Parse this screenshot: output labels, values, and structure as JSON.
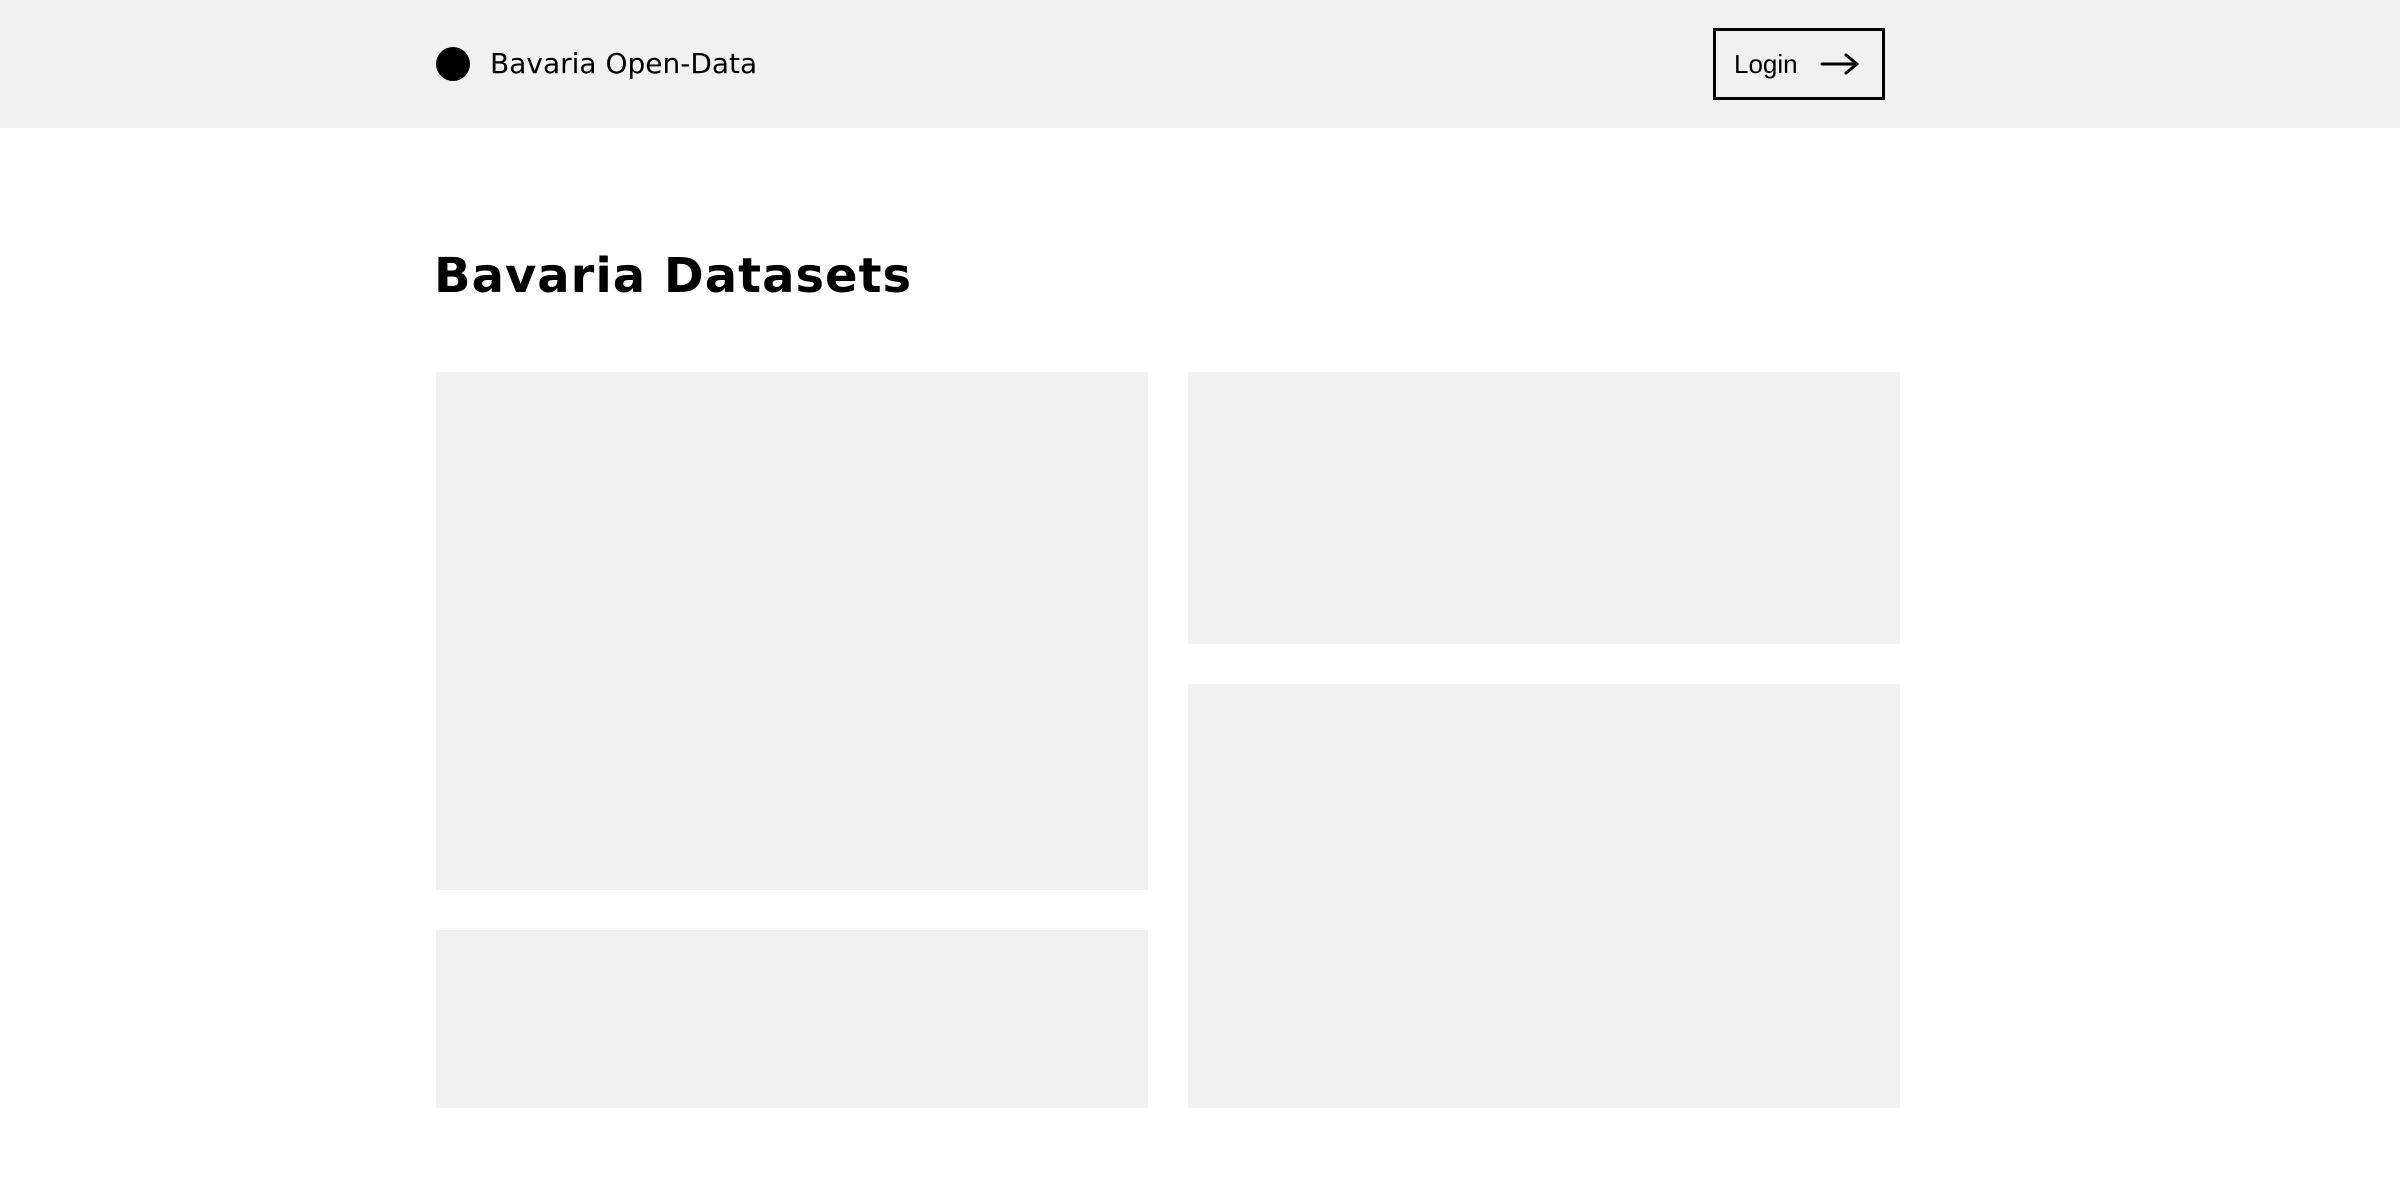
{
  "header": {
    "brand_name": "Bavaria Open-Data",
    "login_label": "Login",
    "login_icon": "arrow-right-icon",
    "logo_icon": "circle-logo"
  },
  "main": {
    "title": "Bavaria Datasets",
    "cards": [
      {
        "id": "dataset-card-1"
      },
      {
        "id": "dataset-card-2"
      },
      {
        "id": "dataset-card-3"
      },
      {
        "id": "dataset-card-4"
      }
    ]
  },
  "colors": {
    "header_background": "#f1f1f1",
    "card_background": "#f1f1f1",
    "text": "#000000",
    "page_background": "#ffffff"
  }
}
